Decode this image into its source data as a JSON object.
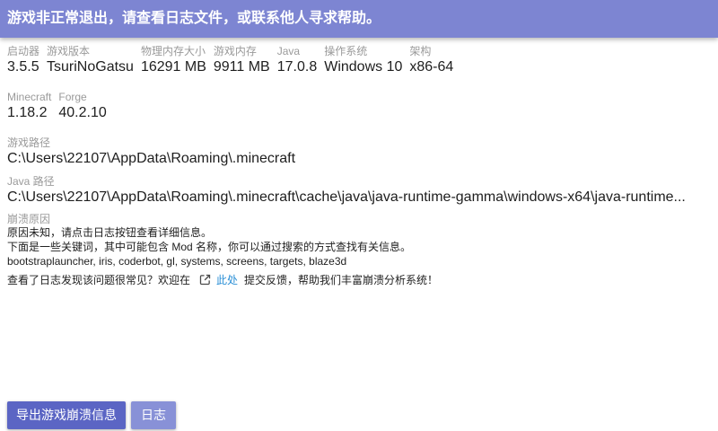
{
  "header": {
    "title": "游戏非正常退出，请查看日志文件，或联系他人寻求帮助。"
  },
  "launcher_info": [
    {
      "label": "启动器",
      "value": "3.5.5"
    },
    {
      "label": "游戏版本",
      "value": "TsuriNoGatsu"
    },
    {
      "label": "物理内存大小",
      "value": "16291 MB"
    },
    {
      "label": "游戏内存",
      "value": "9911 MB"
    },
    {
      "label": "Java",
      "value": "17.0.8"
    },
    {
      "label": "操作系统",
      "value": "Windows 10"
    },
    {
      "label": "架构",
      "value": "x86-64"
    }
  ],
  "mod_loaders": [
    {
      "label": "Minecraft",
      "value": "1.18.2"
    },
    {
      "label": "Forge",
      "value": "40.2.10"
    }
  ],
  "game_dir": {
    "label": "游戏路径",
    "value": "C:\\Users\\22107\\AppData\\Roaming\\.minecraft"
  },
  "java_dir": {
    "label": "Java 路径",
    "value": "C:\\Users\\22107\\AppData\\Roaming\\.minecraft\\cache\\java\\java-runtime-gamma\\windows-x64\\java-runtime..."
  },
  "crash_reason": {
    "label": "崩溃原因",
    "lines": [
      "原因未知，请点击日志按钮查看详细信息。",
      "下面是一些关键词，其中可能包含 Mod 名称，你可以通过搜索的方式查找有关信息。",
      "bootstraplauncher, iris, coderbot, gl, systems, screens, targets, blaze3d"
    ],
    "feedback": {
      "prefix": "查看了日志发现该问题很常见？欢迎在",
      "icon": "external-link-icon",
      "link_text": "此处",
      "suffix": "提交反馈，帮助我们丰富崩溃分析系统！"
    }
  },
  "actions": {
    "export_label": "导出游戏崩溃信息",
    "log_label": "日志"
  },
  "colors": {
    "header_bg": "#7d85d2",
    "primary_button_bg": "#5b65c4",
    "secondary_button_bg": "#8891d7",
    "link": "#2a8fd6"
  }
}
